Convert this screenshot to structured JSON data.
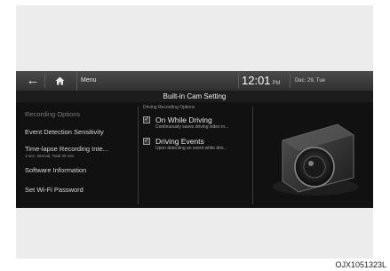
{
  "topbar": {
    "back_icon": "back-arrow-icon",
    "home_icon": "home-icon",
    "menu_label": "Menu",
    "time": "12:01",
    "ampm": "PM",
    "date": "Dec. 29, Tue"
  },
  "title": "Built-in Cam Setting",
  "sidebar": {
    "items": [
      {
        "label": "Recording Options",
        "state": "selected"
      },
      {
        "label": "Event Detection Sensitivity"
      },
      {
        "label": "Time-lapse Recording Inte...",
        "sub": "1-sec. Interval, Total 30 min."
      },
      {
        "label": "Software Information"
      },
      {
        "label": "Set Wi-Fi Password"
      }
    ]
  },
  "main": {
    "section_label": "Driving Recording Options",
    "options": [
      {
        "label": "On While Driving",
        "desc": "Continuously saves driving video in...",
        "checked": true
      },
      {
        "label": "Driving Events",
        "desc": "Upon detecting an event while driv...",
        "checked": true
      }
    ]
  },
  "caption": "OJX1051323L",
  "colors": {
    "screen_bg": "#111111",
    "topbar": "#3a3a3a",
    "frame": "#ececec"
  }
}
